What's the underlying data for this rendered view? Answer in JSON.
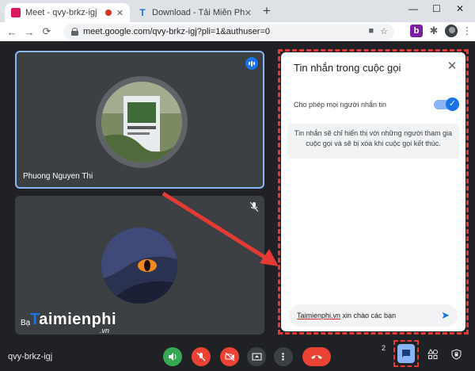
{
  "browser": {
    "tabs": [
      {
        "title": "Meet - qvy-brkz-igj",
        "active": true
      },
      {
        "title": "Download - Tải Miễn Phí VN - Ph",
        "active": false
      }
    ],
    "new_tab_label": "+",
    "window_controls": [
      "—",
      "☐",
      "✕"
    ],
    "address": "meet.google.com/qvy-brkz-igj?pli=1&authuser=0",
    "nav": {
      "back": "←",
      "forward": "→",
      "reload": "⟳"
    },
    "extension_b_label": "b"
  },
  "participants": [
    {
      "name": "Phuong Nguyen Thi",
      "speaking": true
    },
    {
      "name": "Bạ",
      "muted": true
    }
  ],
  "watermark": {
    "brand_prefix": "T",
    "brand_rest": "aimienphi",
    "suffix": ".vn"
  },
  "chat_panel": {
    "title": "Tin nhắn trong cuộc gọi",
    "close_label": "✕",
    "allow_label": "Cho phép mọi người nhắn tin",
    "allow_enabled": true,
    "info_text": "Tin nhắn sẽ chỉ hiển thị với những người tham gia cuộc gọi và sẽ bị xóa khi cuộc gọi kết thúc.",
    "message_brand": "Taimienphi.vn",
    "message_rest": " xin chào các bạn"
  },
  "bottom_bar": {
    "meeting_code": "qvy-brkz-igj",
    "people_count": "2",
    "more_label": "⋮"
  },
  "colors": {
    "accent": "#1a73e8",
    "danger": "#ea4335",
    "speaker_on": "#34a853",
    "annotation": "#e53935"
  }
}
